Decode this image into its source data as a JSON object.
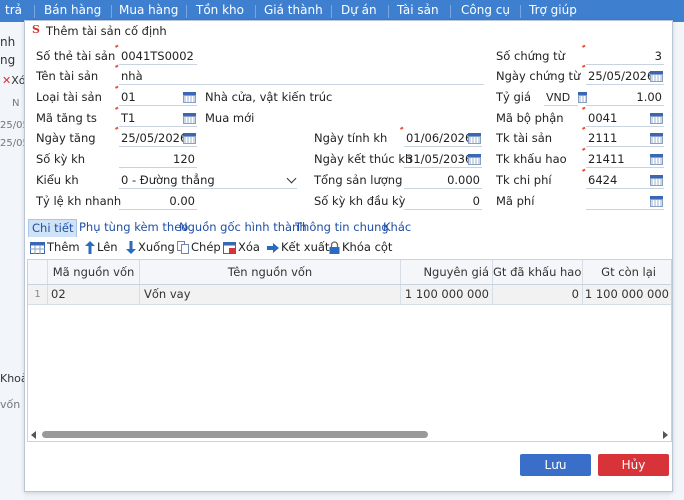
{
  "background": {
    "menu": [
      "trả",
      "Bán hàng",
      "Mua hàng",
      "Tồn kho",
      "Giá thành",
      "Dự án",
      "Tài sản",
      "Công cụ",
      "Trợ giúp"
    ],
    "side_texts": [
      "nh",
      "ng",
      "Xó",
      "N",
      "25/05",
      "25/05",
      "Khoả",
      "vốn"
    ]
  },
  "dialog": {
    "title": "Thêm tài sản cố định",
    "form": {
      "so_the_label": "Số thẻ tài sản",
      "so_the_value": "0041TS0002",
      "ten_ts_label": "Tên tài sản",
      "ten_ts_value": "nhà",
      "loai_ts_label": "Loại tài sản",
      "loai_ts_value": "01",
      "loai_ts_desc": "Nhà cửa, vật kiến trúc",
      "ma_tang_label": "Mã tăng ts",
      "ma_tang_value": "T1",
      "ma_tang_desc": "Mua mới",
      "ngay_tang_label": "Ngày tăng",
      "ngay_tang_value": "25/05/2026",
      "so_ky_kh_label": "Số kỳ kh",
      "so_ky_kh_value": "120",
      "kieu_kh_label": "Kiểu kh",
      "kieu_kh_value": "0 - Đường thẳng",
      "ty_le_label": "Tỷ lệ kh nhanh",
      "ty_le_value": "0.00",
      "ngay_tinh_label": "Ngày tính kh",
      "ngay_tinh_value": "01/06/2026",
      "ngay_kt_label": "Ngày kết thúc kh",
      "ngay_kt_value": "31/05/2036",
      "tong_sl_label": "Tổng sản lượng",
      "tong_sl_value": "0.000",
      "so_ky_dau_label": "Số kỳ kh đầu kỳ",
      "so_ky_dau_value": "0",
      "so_ct_label": "Số chứng từ",
      "so_ct_value": "3",
      "ngay_ct_label": "Ngày chứng từ",
      "ngay_ct_value": "25/05/2026",
      "ty_gia_label": "Tỷ giá",
      "ty_gia_currency": "VND",
      "ty_gia_value": "1.00",
      "ma_bp_label": "Mã bộ phận",
      "ma_bp_value": "0041",
      "tk_ts_label": "Tk tài sản",
      "tk_ts_value": "2111",
      "tk_kh_label": "Tk khấu hao",
      "tk_kh_value": "21411",
      "tk_cp_label": "Tk chi phí",
      "tk_cp_value": "6424",
      "ma_phi_label": "Mã phí",
      "ma_phi_value": ""
    },
    "tabs": [
      "Chi tiết",
      "Phụ tùng kèm theo",
      "Nguồn gốc hình thành",
      "Thông tin chung",
      "Khác"
    ],
    "toolbar": [
      "Thêm",
      "Lên",
      "Xuống",
      "Chép",
      "Xóa",
      "Kết xuất",
      "Khóa cột"
    ],
    "grid": {
      "columns": [
        "Mã nguồn vốn",
        "Tên nguồn vốn",
        "Nguyên giá",
        "Gt đã khấu hao",
        "Gt còn lại"
      ],
      "rows": [
        {
          "no": "1",
          "ma": "02",
          "ten": "Vốn vay",
          "nguyen_gia": "1 100 000 000",
          "da_kh": "0",
          "con_lai": "1 100 000 000"
        }
      ]
    },
    "buttons": {
      "save": "Lưu",
      "cancel": "Hủy"
    },
    "colors": {
      "save": "#3a6fc9",
      "cancel": "#d9333a",
      "menu_bar": "#3f7fd0"
    }
  }
}
